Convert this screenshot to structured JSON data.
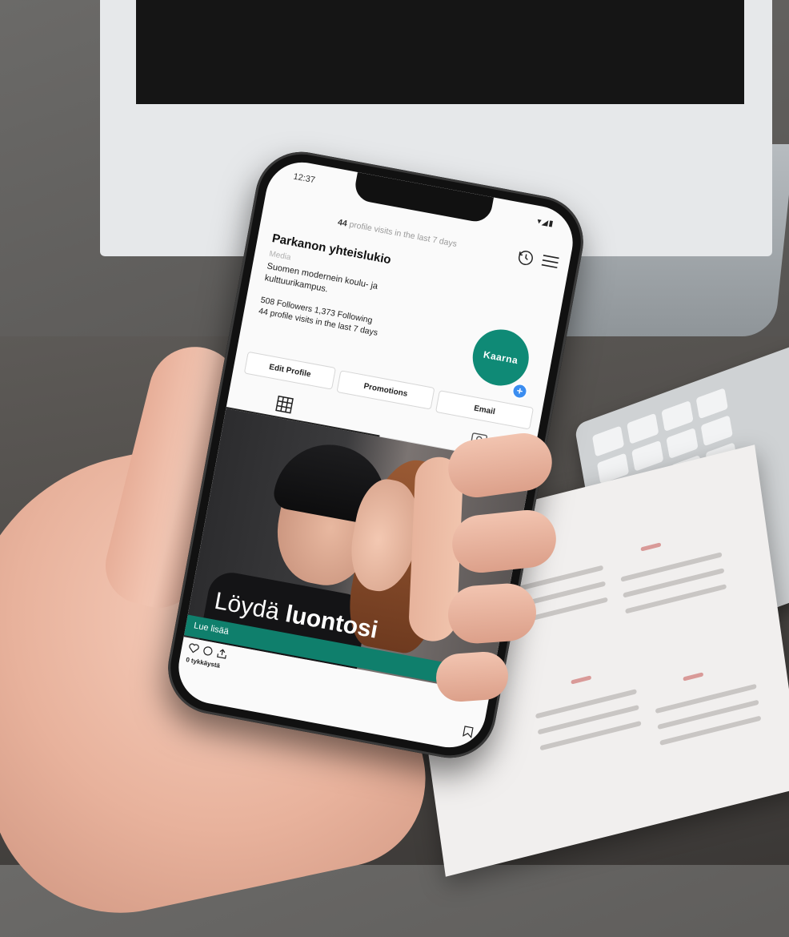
{
  "status_bar": {
    "time": "12:37",
    "icons": "▾◢▮"
  },
  "header": {
    "visits_count": "44",
    "visits_text": "profile visits in the last 7 days"
  },
  "profile": {
    "name": "Parkanon yhteislukio",
    "category": "Media",
    "bio": "Suomen modernein koulu- ja kulttuurikampus.",
    "stats": "508 Followers  1,373 Following",
    "visits": "44 profile visits in the last 7 days",
    "avatar_text": "Kaarna",
    "avatar_plus": "+"
  },
  "buttons": {
    "edit_profile": "Edit Profile",
    "promotions": "Promotions",
    "email": "Email"
  },
  "post": {
    "title_light": "Löydä ",
    "title_bold": "luontosi",
    "cta": "Lue lisää",
    "likes_text": "0 tykkäystä"
  },
  "colors": {
    "brand_green": "#0f8a76",
    "cta_green": "#0f7f6c",
    "plus_blue": "#3b8df0"
  },
  "icons": [
    "history-icon",
    "menu-icon",
    "grid-icon",
    "tagged-icon",
    "heart-icon",
    "comment-icon",
    "share-icon",
    "bookmark-icon"
  ]
}
